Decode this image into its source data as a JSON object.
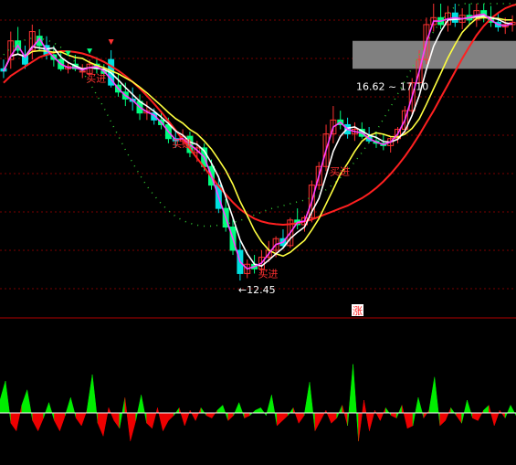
{
  "chart_data": [
    {
      "type": "candlestick",
      "panel": "main",
      "grid": true,
      "colors": {
        "up": "#ff3232",
        "down": "#00ff7f",
        "down_alt": "#00e0e0",
        "ma_short": "#ff40ff",
        "ma_mid": "#ffffff",
        "ma_long": "#ffff40",
        "ma_trend": "#ff2020",
        "dotted": "#33cc33",
        "band": "#808080"
      },
      "ylim": [
        12.0,
        18.4
      ],
      "candles": [
        {
          "o": 17.0,
          "h": 17.2,
          "l": 16.8,
          "c": 16.95
        },
        {
          "o": 17.2,
          "h": 17.8,
          "l": 17.0,
          "c": 17.6
        },
        {
          "o": 17.6,
          "h": 17.9,
          "l": 17.3,
          "c": 17.4
        },
        {
          "o": 17.3,
          "h": 17.5,
          "l": 17.0,
          "c": 17.1
        },
        {
          "o": 17.4,
          "h": 17.95,
          "l": 17.2,
          "c": 17.8
        },
        {
          "o": 17.7,
          "h": 17.85,
          "l": 17.4,
          "c": 17.5
        },
        {
          "o": 17.5,
          "h": 17.7,
          "l": 17.2,
          "c": 17.3
        },
        {
          "o": 17.3,
          "h": 17.5,
          "l": 17.05,
          "c": 17.2
        },
        {
          "o": 17.2,
          "h": 17.4,
          "l": 16.95,
          "c": 17.0
        },
        {
          "o": 17.0,
          "h": 17.15,
          "l": 16.9,
          "c": 17.05
        },
        {
          "o": 17.1,
          "h": 17.3,
          "l": 16.95,
          "c": 17.0
        },
        {
          "o": 16.95,
          "h": 17.1,
          "l": 16.8,
          "c": 16.95
        },
        {
          "o": 16.9,
          "h": 17.2,
          "l": 16.85,
          "c": 17.1
        },
        {
          "o": 17.1,
          "h": 17.25,
          "l": 16.9,
          "c": 17.0
        },
        {
          "o": 16.95,
          "h": 17.1,
          "l": 16.8,
          "c": 16.9
        },
        {
          "o": 17.2,
          "h": 17.4,
          "l": 16.6,
          "c": 16.65
        },
        {
          "o": 16.65,
          "h": 16.9,
          "l": 16.4,
          "c": 16.5
        },
        {
          "o": 16.5,
          "h": 16.7,
          "l": 16.2,
          "c": 16.35
        },
        {
          "o": 16.35,
          "h": 16.6,
          "l": 16.1,
          "c": 16.3
        },
        {
          "o": 16.3,
          "h": 16.45,
          "l": 15.9,
          "c": 16.05
        },
        {
          "o": 16.05,
          "h": 16.3,
          "l": 15.9,
          "c": 16.1
        },
        {
          "o": 16.05,
          "h": 16.15,
          "l": 15.8,
          "c": 15.9
        },
        {
          "o": 15.9,
          "h": 16.1,
          "l": 15.7,
          "c": 15.8
        },
        {
          "o": 15.8,
          "h": 15.95,
          "l": 15.4,
          "c": 15.5
        },
        {
          "o": 15.5,
          "h": 15.7,
          "l": 15.3,
          "c": 15.45
        },
        {
          "o": 15.45,
          "h": 15.7,
          "l": 15.35,
          "c": 15.55
        },
        {
          "o": 15.55,
          "h": 15.65,
          "l": 15.1,
          "c": 15.2
        },
        {
          "o": 15.2,
          "h": 15.45,
          "l": 15.0,
          "c": 15.3
        },
        {
          "o": 15.3,
          "h": 15.4,
          "l": 14.8,
          "c": 14.9
        },
        {
          "o": 14.9,
          "h": 15.05,
          "l": 14.4,
          "c": 14.5
        },
        {
          "o": 14.5,
          "h": 14.7,
          "l": 13.9,
          "c": 14.0
        },
        {
          "o": 14.0,
          "h": 14.2,
          "l": 13.5,
          "c": 13.6
        },
        {
          "o": 13.6,
          "h": 13.8,
          "l": 13.0,
          "c": 13.1
        },
        {
          "o": 13.1,
          "h": 13.3,
          "l": 12.45,
          "c": 12.6
        },
        {
          "o": 12.6,
          "h": 12.9,
          "l": 12.5,
          "c": 12.8
        },
        {
          "o": 12.8,
          "h": 13.0,
          "l": 12.6,
          "c": 12.7
        },
        {
          "o": 12.7,
          "h": 13.1,
          "l": 12.6,
          "c": 12.95
        },
        {
          "o": 12.95,
          "h": 13.3,
          "l": 12.85,
          "c": 13.1
        },
        {
          "o": 13.1,
          "h": 13.4,
          "l": 12.95,
          "c": 13.35
        },
        {
          "o": 13.35,
          "h": 13.55,
          "l": 13.15,
          "c": 13.2
        },
        {
          "o": 13.2,
          "h": 13.8,
          "l": 13.15,
          "c": 13.75
        },
        {
          "o": 13.75,
          "h": 14.0,
          "l": 13.55,
          "c": 13.65
        },
        {
          "o": 13.65,
          "h": 13.85,
          "l": 13.5,
          "c": 13.8
        },
        {
          "o": 13.8,
          "h": 14.6,
          "l": 13.7,
          "c": 14.5
        },
        {
          "o": 14.5,
          "h": 15.0,
          "l": 14.4,
          "c": 14.9
        },
        {
          "o": 14.9,
          "h": 15.8,
          "l": 14.8,
          "c": 15.6
        },
        {
          "o": 15.6,
          "h": 16.2,
          "l": 15.4,
          "c": 15.9
        },
        {
          "o": 15.9,
          "h": 16.1,
          "l": 15.7,
          "c": 15.8
        },
        {
          "o": 15.8,
          "h": 15.95,
          "l": 15.5,
          "c": 15.6
        },
        {
          "o": 15.6,
          "h": 15.85,
          "l": 15.45,
          "c": 15.7
        },
        {
          "o": 15.7,
          "h": 15.85,
          "l": 15.5,
          "c": 15.55
        },
        {
          "o": 15.55,
          "h": 15.75,
          "l": 15.4,
          "c": 15.45
        },
        {
          "o": 15.45,
          "h": 15.65,
          "l": 15.3,
          "c": 15.4
        },
        {
          "o": 15.4,
          "h": 15.6,
          "l": 15.25,
          "c": 15.35
        },
        {
          "o": 15.35,
          "h": 15.55,
          "l": 15.2,
          "c": 15.5
        },
        {
          "o": 15.5,
          "h": 15.75,
          "l": 15.4,
          "c": 15.7
        },
        {
          "o": 15.7,
          "h": 16.2,
          "l": 15.6,
          "c": 16.1
        },
        {
          "o": 16.1,
          "h": 16.8,
          "l": 16.0,
          "c": 16.7
        },
        {
          "o": 16.7,
          "h": 17.4,
          "l": 16.6,
          "c": 17.2
        },
        {
          "o": 17.2,
          "h": 18.1,
          "l": 17.1,
          "c": 17.95
        },
        {
          "o": 17.95,
          "h": 18.4,
          "l": 17.8,
          "c": 18.1
        },
        {
          "o": 18.1,
          "h": 18.4,
          "l": 17.85,
          "c": 17.95
        },
        {
          "o": 17.95,
          "h": 18.35,
          "l": 17.8,
          "c": 18.2
        },
        {
          "o": 18.2,
          "h": 18.4,
          "l": 17.9,
          "c": 18.0
        },
        {
          "o": 18.0,
          "h": 18.3,
          "l": 17.85,
          "c": 18.15
        },
        {
          "o": 18.15,
          "h": 18.4,
          "l": 17.95,
          "c": 18.05
        },
        {
          "o": 18.05,
          "h": 18.4,
          "l": 17.9,
          "c": 18.25
        },
        {
          "o": 18.25,
          "h": 18.4,
          "l": 18.0,
          "c": 18.1
        },
        {
          "o": 18.1,
          "h": 18.35,
          "l": 17.9,
          "c": 18.0
        },
        {
          "o": 18.0,
          "h": 18.2,
          "l": 17.8,
          "c": 17.9
        },
        {
          "o": 17.9,
          "h": 18.1,
          "l": 17.75,
          "c": 17.95
        },
        {
          "o": 17.95,
          "h": 18.15,
          "l": 17.8,
          "c": 18.0
        }
      ],
      "trend_line": [
        16.7,
        16.85,
        16.95,
        17.05,
        17.15,
        17.25,
        17.3,
        17.35,
        17.38,
        17.38,
        17.36,
        17.33,
        17.28,
        17.22,
        17.15,
        17.06,
        16.96,
        16.85,
        16.72,
        16.58,
        16.42,
        16.25,
        16.07,
        15.88,
        15.68,
        15.48,
        15.28,
        15.08,
        14.88,
        14.68,
        14.48,
        14.3,
        14.13,
        13.98,
        13.87,
        13.78,
        13.72,
        13.68,
        13.66,
        13.65,
        13.66,
        13.68,
        13.72,
        13.76,
        13.82,
        13.88,
        13.94,
        14.0,
        14.06,
        14.14,
        14.22,
        14.32,
        14.44,
        14.58,
        14.74,
        14.92,
        15.12,
        15.34,
        15.58,
        15.84,
        16.1,
        16.38,
        16.66,
        16.94,
        17.22,
        17.48,
        17.72,
        17.92,
        18.08,
        18.2,
        18.3,
        18.36,
        18.4
      ],
      "dotted_line": [
        17.3,
        17.45,
        17.55,
        17.62,
        17.66,
        17.66,
        17.62,
        17.56,
        17.46,
        17.32,
        17.14,
        16.94,
        16.7,
        16.44,
        16.16,
        15.86,
        15.56,
        15.26,
        14.98,
        14.72,
        14.48,
        14.28,
        14.1,
        13.95,
        13.83,
        13.74,
        13.68,
        13.64,
        13.62,
        13.62,
        13.64,
        13.66,
        13.7,
        13.74,
        13.8,
        13.86,
        13.92,
        13.98,
        14.02,
        14.06,
        14.1,
        14.14,
        14.18,
        14.24,
        14.3,
        14.4,
        14.52,
        14.66,
        14.82,
        15.0,
        15.2,
        15.42,
        15.66,
        15.92,
        16.18,
        16.46,
        16.74,
        17.02,
        17.3,
        17.56,
        17.8,
        18.02,
        18.2,
        18.34,
        18.4,
        18.4,
        18.4,
        18.4,
        18.4,
        18.4,
        18.4,
        18.4,
        18.4
      ],
      "band": [
        17.0,
        17.6
      ],
      "annotations": {
        "buy_label": "买进",
        "low_label": "←12.45",
        "low_price": 12.45,
        "range_label": "16.62 ~ 17.10",
        "range_low": 16.62,
        "range_high": 17.1,
        "buy_points": [
          11,
          23,
          35,
          45
        ]
      }
    },
    {
      "type": "area",
      "panel": "indicator",
      "marker_label": "涨",
      "colors": {
        "positive": "#00ee00",
        "negative": "#ee0000",
        "marker": "#ff2020"
      },
      "values": [
        10,
        25,
        -8,
        -14,
        6,
        18,
        -6,
        -14,
        -4,
        8,
        -6,
        -14,
        -2,
        12,
        -4,
        -10,
        2,
        30,
        -8,
        -18,
        4,
        -6,
        -12,
        12,
        -22,
        -6,
        14,
        -8,
        -12,
        4,
        -14,
        -6,
        -2,
        4,
        -10,
        2,
        -6,
        4,
        -2,
        -4,
        2,
        6,
        -6,
        -2,
        8,
        -4,
        -2,
        2,
        4,
        -2,
        14,
        -10,
        -6,
        -2,
        4,
        -8,
        -2,
        24,
        -14,
        -6,
        2,
        -8,
        -4,
        6,
        -10,
        38,
        -22,
        10,
        -14,
        2,
        -6,
        4,
        -2,
        -4,
        6,
        -12,
        -10,
        12,
        -4,
        2,
        28,
        -10,
        -6,
        4,
        -2,
        -8,
        10,
        -4,
        -6,
        2,
        6,
        -10,
        2,
        -4,
        6,
        -2
      ]
    }
  ]
}
